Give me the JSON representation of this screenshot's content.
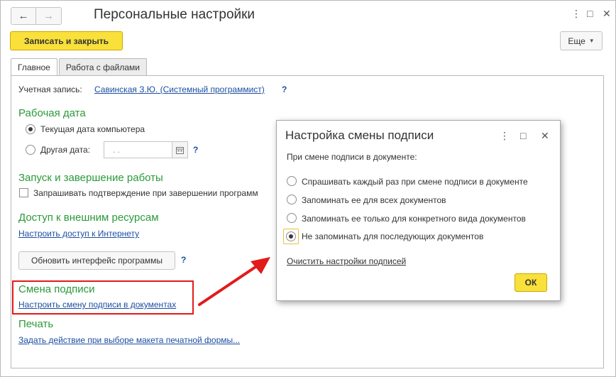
{
  "window": {
    "title": "Персональные настройки",
    "back_icon": "arrow-left-icon",
    "forward_icon": "arrow-right-icon"
  },
  "toolbar": {
    "save_close_label": "Записать и закрыть",
    "more_label": "Еще"
  },
  "tabs": [
    {
      "label": "Главное",
      "active": true
    },
    {
      "label": "Работа с файлами",
      "active": false
    }
  ],
  "main": {
    "account_label": "Учетная запись:",
    "account_value": "Савинская З.Ю. (Системный программист)",
    "help_mark": "?",
    "work_date": {
      "title": "Рабочая дата",
      "option_current": "Текущая дата компьютера",
      "option_other": "Другая дата:",
      "date_value": ".   .",
      "selected": "current"
    },
    "startup": {
      "title": "Запуск и завершение работы",
      "confirm_exit_label": "Запрашивать подтверждение при завершении программ",
      "confirm_exit_checked": false
    },
    "external": {
      "title": "Доступ к внешним ресурсам",
      "internet_link": "Настроить доступ к Интернету"
    },
    "refresh_button": "Обновить интерфейс программы",
    "signature": {
      "title": "Смена подписи",
      "link": "Настроить смену подписи в документах"
    },
    "print": {
      "title": "Печать",
      "link": "Задать действие при выборе макета печатной формы..."
    }
  },
  "dialog": {
    "title": "Настройка смены подписи",
    "prompt": "При смене подписи в документе:",
    "options": [
      "Спрашивать каждый раз при смене подписи в документе",
      "Запоминать ее для всех документов",
      "Запоминать ее только для конкретного вида документов",
      "Не запоминать для последующих документов"
    ],
    "selected_index": 3,
    "clear_link": "Очистить настройки подписей",
    "ok_label": "ОК"
  },
  "colors": {
    "accent_yellow": "#f9e03a",
    "section_green": "#2b9a3a",
    "link_blue": "#1c4fa1",
    "annotation_red": "#e11b1b"
  }
}
